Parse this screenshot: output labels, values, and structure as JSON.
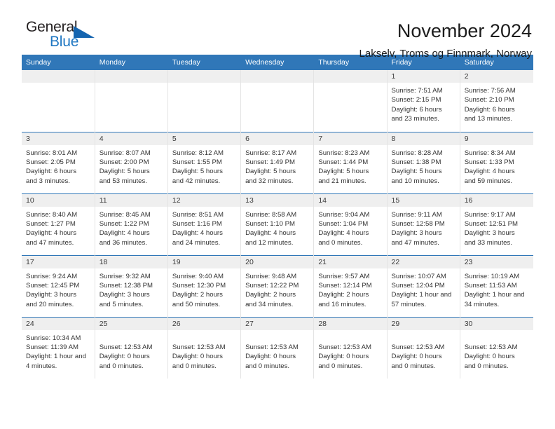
{
  "logo": {
    "word_one": "General",
    "word_two": "Blue",
    "triangle": "blue-triangle-icon"
  },
  "header": {
    "title": "November 2024",
    "subtitle": "Lakselv, Troms og Finnmark, Norway"
  },
  "colors": {
    "header_blue": "#3077b8",
    "daynum_gray": "#efefef",
    "logo_blue": "#1f77c2",
    "text": "#333333"
  },
  "calendar": {
    "weekday_headers": [
      "Sunday",
      "Monday",
      "Tuesday",
      "Wednesday",
      "Thursday",
      "Friday",
      "Saturday"
    ],
    "weeks": [
      [
        {
          "day": "",
          "lines": [],
          "empty": true
        },
        {
          "day": "",
          "lines": [],
          "empty": true
        },
        {
          "day": "",
          "lines": [],
          "empty": true
        },
        {
          "day": "",
          "lines": [],
          "empty": true
        },
        {
          "day": "",
          "lines": [],
          "empty": true
        },
        {
          "day": "1",
          "lines": [
            "Sunrise: 7:51 AM",
            "Sunset: 2:15 PM",
            "Daylight: 6 hours",
            "and 23 minutes."
          ]
        },
        {
          "day": "2",
          "lines": [
            "Sunrise: 7:56 AM",
            "Sunset: 2:10 PM",
            "Daylight: 6 hours",
            "and 13 minutes."
          ]
        }
      ],
      [
        {
          "day": "3",
          "lines": [
            "Sunrise: 8:01 AM",
            "Sunset: 2:05 PM",
            "Daylight: 6 hours",
            "and 3 minutes."
          ]
        },
        {
          "day": "4",
          "lines": [
            "Sunrise: 8:07 AM",
            "Sunset: 2:00 PM",
            "Daylight: 5 hours",
            "and 53 minutes."
          ]
        },
        {
          "day": "5",
          "lines": [
            "Sunrise: 8:12 AM",
            "Sunset: 1:55 PM",
            "Daylight: 5 hours",
            "and 42 minutes."
          ]
        },
        {
          "day": "6",
          "lines": [
            "Sunrise: 8:17 AM",
            "Sunset: 1:49 PM",
            "Daylight: 5 hours",
            "and 32 minutes."
          ]
        },
        {
          "day": "7",
          "lines": [
            "Sunrise: 8:23 AM",
            "Sunset: 1:44 PM",
            "Daylight: 5 hours",
            "and 21 minutes."
          ]
        },
        {
          "day": "8",
          "lines": [
            "Sunrise: 8:28 AM",
            "Sunset: 1:38 PM",
            "Daylight: 5 hours",
            "and 10 minutes."
          ]
        },
        {
          "day": "9",
          "lines": [
            "Sunrise: 8:34 AM",
            "Sunset: 1:33 PM",
            "Daylight: 4 hours",
            "and 59 minutes."
          ]
        }
      ],
      [
        {
          "day": "10",
          "lines": [
            "Sunrise: 8:40 AM",
            "Sunset: 1:27 PM",
            "Daylight: 4 hours",
            "and 47 minutes."
          ]
        },
        {
          "day": "11",
          "lines": [
            "Sunrise: 8:45 AM",
            "Sunset: 1:22 PM",
            "Daylight: 4 hours",
            "and 36 minutes."
          ]
        },
        {
          "day": "12",
          "lines": [
            "Sunrise: 8:51 AM",
            "Sunset: 1:16 PM",
            "Daylight: 4 hours",
            "and 24 minutes."
          ]
        },
        {
          "day": "13",
          "lines": [
            "Sunrise: 8:58 AM",
            "Sunset: 1:10 PM",
            "Daylight: 4 hours",
            "and 12 minutes."
          ]
        },
        {
          "day": "14",
          "lines": [
            "Sunrise: 9:04 AM",
            "Sunset: 1:04 PM",
            "Daylight: 4 hours",
            "and 0 minutes."
          ]
        },
        {
          "day": "15",
          "lines": [
            "Sunrise: 9:11 AM",
            "Sunset: 12:58 PM",
            "Daylight: 3 hours",
            "and 47 minutes."
          ]
        },
        {
          "day": "16",
          "lines": [
            "Sunrise: 9:17 AM",
            "Sunset: 12:51 PM",
            "Daylight: 3 hours",
            "and 33 minutes."
          ]
        }
      ],
      [
        {
          "day": "17",
          "lines": [
            "Sunrise: 9:24 AM",
            "Sunset: 12:45 PM",
            "Daylight: 3 hours",
            "and 20 minutes."
          ]
        },
        {
          "day": "18",
          "lines": [
            "Sunrise: 9:32 AM",
            "Sunset: 12:38 PM",
            "Daylight: 3 hours",
            "and 5 minutes."
          ]
        },
        {
          "day": "19",
          "lines": [
            "Sunrise: 9:40 AM",
            "Sunset: 12:30 PM",
            "Daylight: 2 hours",
            "and 50 minutes."
          ]
        },
        {
          "day": "20",
          "lines": [
            "Sunrise: 9:48 AM",
            "Sunset: 12:22 PM",
            "Daylight: 2 hours",
            "and 34 minutes."
          ]
        },
        {
          "day": "21",
          "lines": [
            "Sunrise: 9:57 AM",
            "Sunset: 12:14 PM",
            "Daylight: 2 hours",
            "and 16 minutes."
          ]
        },
        {
          "day": "22",
          "lines": [
            "Sunrise: 10:07 AM",
            "Sunset: 12:04 PM",
            "Daylight: 1 hour and",
            "57 minutes."
          ]
        },
        {
          "day": "23",
          "lines": [
            "Sunrise: 10:19 AM",
            "Sunset: 11:53 AM",
            "Daylight: 1 hour and",
            "34 minutes."
          ]
        }
      ],
      [
        {
          "day": "24",
          "lines": [
            "Sunrise: 10:34 AM",
            "Sunset: 11:39 AM",
            "Daylight: 1 hour and",
            "4 minutes."
          ]
        },
        {
          "day": "25",
          "lines": [
            "",
            "Sunset: 12:53 AM",
            "Daylight: 0 hours",
            "and 0 minutes."
          ]
        },
        {
          "day": "26",
          "lines": [
            "",
            "Sunset: 12:53 AM",
            "Daylight: 0 hours",
            "and 0 minutes."
          ]
        },
        {
          "day": "27",
          "lines": [
            "",
            "Sunset: 12:53 AM",
            "Daylight: 0 hours",
            "and 0 minutes."
          ]
        },
        {
          "day": "28",
          "lines": [
            "",
            "Sunset: 12:53 AM",
            "Daylight: 0 hours",
            "and 0 minutes."
          ]
        },
        {
          "day": "29",
          "lines": [
            "",
            "Sunset: 12:53 AM",
            "Daylight: 0 hours",
            "and 0 minutes."
          ]
        },
        {
          "day": "30",
          "lines": [
            "",
            "Sunset: 12:53 AM",
            "Daylight: 0 hours",
            "and 0 minutes."
          ]
        }
      ]
    ]
  }
}
